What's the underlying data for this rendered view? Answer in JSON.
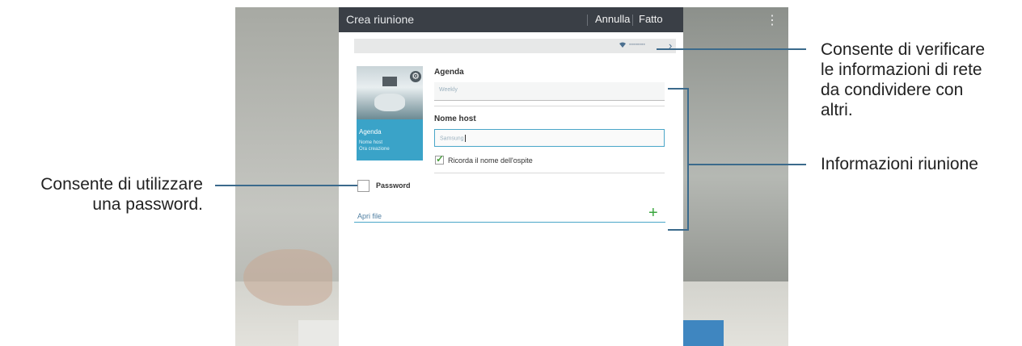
{
  "dialog": {
    "title": "Crea riunione",
    "cancel_label": "Annulla",
    "done_label": "Fatto",
    "network_name": "▪▪▪▪▪▪▪▪",
    "card": {
      "title": "Agenda",
      "line1": "Nome host",
      "line2": "Ora creazione"
    },
    "agenda": {
      "label": "Agenda",
      "value": "Weekly"
    },
    "host": {
      "label": "Nome host",
      "value": "Samsung"
    },
    "remember_label": "Ricorda il nome dell'ospite",
    "remember_checked": true,
    "password_label": "Password",
    "password_checked": false,
    "open_file_label": "Apri file"
  },
  "callouts": {
    "network": [
      "Consente di verificare",
      "le informazioni di rete",
      "da condividere con",
      "altri."
    ],
    "meeting_info": "Informazioni riunione",
    "password": [
      "Consente di utilizzare",
      "una password."
    ]
  },
  "colors": {
    "titlebar": "#3a3f46",
    "accent": "#3aa3c8",
    "check": "#4aa03e",
    "callout_line": "#3b6a8c"
  }
}
